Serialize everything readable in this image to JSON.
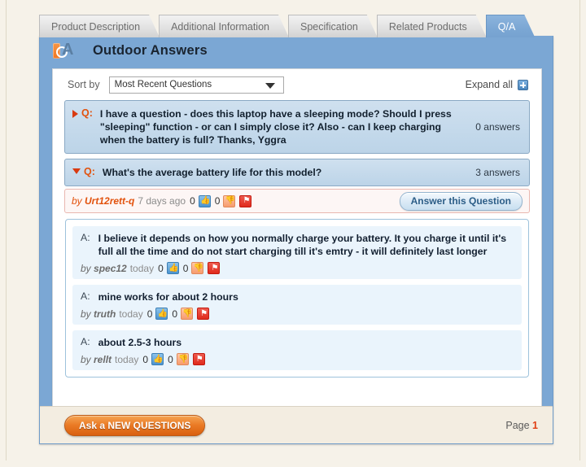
{
  "tabs": [
    {
      "label": "Product Description",
      "active": false
    },
    {
      "label": "Additional Information",
      "active": false
    },
    {
      "label": "Specification",
      "active": false
    },
    {
      "label": "Related Products",
      "active": false
    },
    {
      "label": "Q/A",
      "active": true
    }
  ],
  "header": {
    "title": "Outdoor Answers",
    "logo_alt": "qa-logo"
  },
  "sort": {
    "label": "Sort by",
    "selected": "Most Recent Questions",
    "options": [
      "Most Recent Questions"
    ],
    "expand_all": "Expand all"
  },
  "questions": [
    {
      "state": "collapsed",
      "marker": "Q:",
      "text": "I have a question - does this laptop have a sleeping mode? Should I press \"sleeping\" function - or can I simply close it? Also - can I keep charging when the battery is full? Thanks, Yggra",
      "answer_count": "0 answers"
    },
    {
      "state": "expanded",
      "marker": "Q:",
      "text": "What's the average battery life for this model?",
      "answer_count": "3 answers",
      "meta": {
        "by": "by ",
        "author": "Urt12rett-q",
        "time": "7 days ago",
        "up_count": "0",
        "down_count": "0"
      },
      "answer_button": "Answer this Question",
      "answers": [
        {
          "marker": "A:",
          "text": "I believe it depends on how you normally charge your battery. It you charge it until it's full all the time and do not start charging till it's emtry - it will definitely last longer",
          "by": "by ",
          "author": "spec12",
          "time": "today",
          "up_count": "0",
          "down_count": "0"
        },
        {
          "marker": "A:",
          "text": "mine works for about 2 hours",
          "by": "by ",
          "author": "truth",
          "time": "today",
          "up_count": "0",
          "down_count": "0"
        },
        {
          "marker": "A:",
          "text": "about 2.5-3 hours",
          "by": "by ",
          "author": "rellt",
          "time": "today",
          "up_count": "0",
          "down_count": "0"
        }
      ]
    }
  ],
  "footer": {
    "ask_button": "Ask a NEW QUESTIONS",
    "page_label": "Page",
    "page_number": "1"
  },
  "colors": {
    "panel_blue": "#7ba7d4",
    "accent_orange": "#e2520d",
    "flag_red": "#e02a1c",
    "thumb_blue": "#4a93d0"
  }
}
